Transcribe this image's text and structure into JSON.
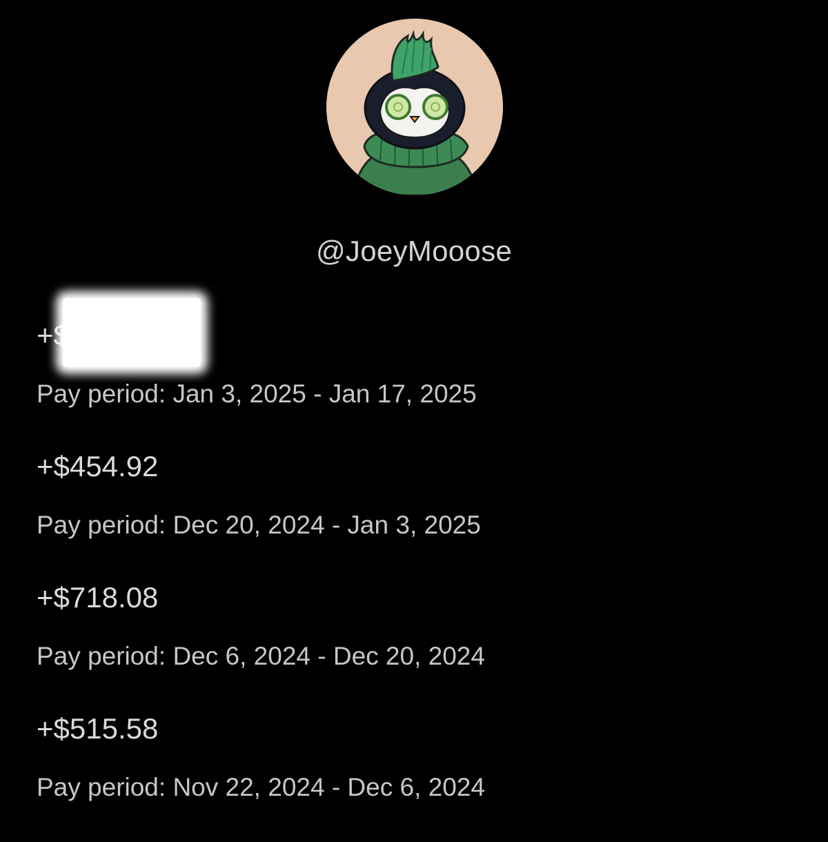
{
  "profile": {
    "avatar_icon": "penguin-avatar-icon",
    "handle": "@JoeyMooose"
  },
  "payouts": [
    {
      "amount": "+$",
      "amount_redacted": true,
      "period": "Pay period: Jan 3, 2025 - Jan 17, 2025"
    },
    {
      "amount": "+$454.92",
      "period": "Pay period: Dec 20, 2024 - Jan 3, 2025"
    },
    {
      "amount": "+$718.08",
      "period": "Pay period: Dec 6, 2024 - Dec 20, 2024"
    },
    {
      "amount": "+$515.58",
      "period": "Pay period: Nov 22, 2024 - Dec 6, 2024"
    }
  ],
  "colors": {
    "background": "#000000",
    "text_primary": "#dadada",
    "text_secondary": "#c7c7c7",
    "avatar_bg": "#e8c8ae",
    "hat_green": "#3fa36a",
    "sweater_green": "#3b7f4e",
    "redaction": "#ffffff"
  }
}
